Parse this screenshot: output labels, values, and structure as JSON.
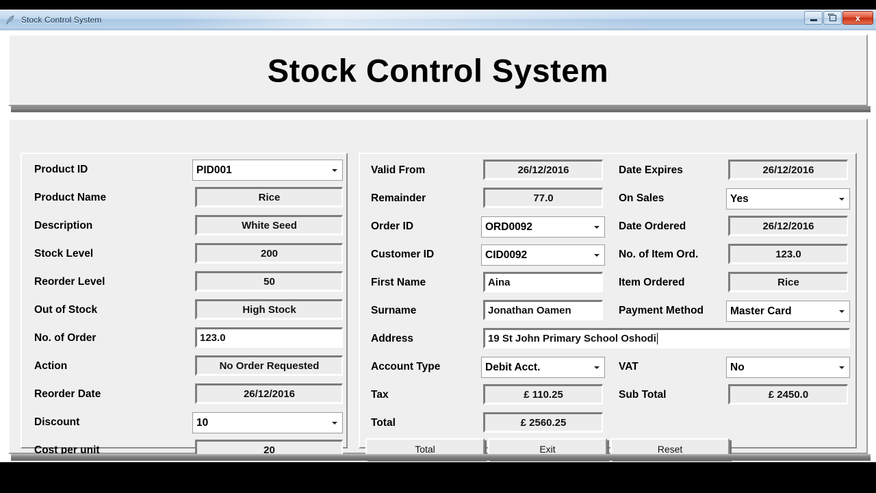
{
  "window": {
    "title": "Stock Control System",
    "icon": "feather-quill-icon",
    "controls": {
      "minimize": "–",
      "maximize": "❐",
      "close": "x"
    }
  },
  "banner": {
    "title": "Stock Control System"
  },
  "left_panel": {
    "rows": [
      {
        "label": "Product ID",
        "value": "PID001",
        "type": "combo"
      },
      {
        "label": "Product Name",
        "value": "Rice",
        "type": "display"
      },
      {
        "label": "Description",
        "value": "White Seed",
        "type": "display"
      },
      {
        "label": "Stock Level",
        "value": "200",
        "type": "display"
      },
      {
        "label": "Reorder Level",
        "value": "50",
        "type": "display"
      },
      {
        "label": "Out of Stock",
        "value": "High Stock",
        "type": "display"
      },
      {
        "label": "No. of Order",
        "value": "123.0",
        "type": "edit"
      },
      {
        "label": "Action",
        "value": "No Order Requested",
        "type": "display"
      },
      {
        "label": "Reorder Date",
        "value": "26/12/2016",
        "type": "display"
      },
      {
        "label": "Discount",
        "value": "10",
        "type": "combo"
      },
      {
        "label": "Cost per unit",
        "value": "20",
        "type": "display"
      }
    ]
  },
  "right_panel": {
    "col1": [
      {
        "label": "Valid From",
        "value": "26/12/2016",
        "type": "display"
      },
      {
        "label": "Remainder",
        "value": "77.0",
        "type": "display"
      },
      {
        "label": "Order ID",
        "value": "ORD0092",
        "type": "combo"
      },
      {
        "label": "Customer ID",
        "value": "CID0092",
        "type": "combo"
      },
      {
        "label": "First Name",
        "value": "Aina",
        "type": "edit"
      },
      {
        "label": "Surname",
        "value": "Jonathan Oamen",
        "type": "edit"
      }
    ],
    "col2": [
      {
        "label": "Date Expires",
        "value": "26/12/2016",
        "type": "display"
      },
      {
        "label": "On Sales",
        "value": "Yes",
        "type": "combo"
      },
      {
        "label": "Date Ordered",
        "value": "26/12/2016",
        "type": "display"
      },
      {
        "label": "No. of Item Ord.",
        "value": "123.0",
        "type": "display"
      },
      {
        "label": "Item Ordered",
        "value": "Rice",
        "type": "display"
      },
      {
        "label": "Payment Method",
        "value": "Master Card",
        "type": "combo"
      }
    ],
    "address": {
      "label": "Address",
      "value": "19 St John Primary School Oshodi"
    },
    "account_type": {
      "label": "Account Type",
      "value": "Debit Acct."
    },
    "vat": {
      "label": "VAT",
      "value": "No"
    },
    "tax": {
      "label": "Tax",
      "value": "£ 110.25"
    },
    "sub_total": {
      "label": "Sub Total",
      "value": "£ 2450.0"
    },
    "total": {
      "label": "Total",
      "value": "£ 2560.25"
    },
    "buttons": [
      {
        "label": "Total"
      },
      {
        "label": "Exit"
      },
      {
        "label": "Reset"
      }
    ]
  },
  "colors": {
    "panel_bg": "#efefef",
    "field_bg": "#ececec",
    "field_shadow": "#7d7d7d",
    "field_highlight": "#ffffff",
    "titlebar_text": "#17334f",
    "close_button": "#c72f14"
  }
}
